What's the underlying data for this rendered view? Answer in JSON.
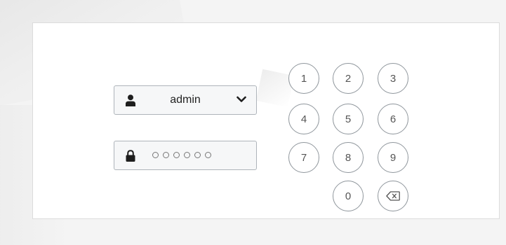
{
  "login": {
    "username": "admin",
    "password_length": 6,
    "keypad": [
      "1",
      "2",
      "3",
      "4",
      "5",
      "6",
      "7",
      "8",
      "9",
      "0"
    ],
    "icons": {
      "user": "user-icon",
      "lock": "lock-icon",
      "dropdown": "chevron-down-icon",
      "backspace": "backspace-icon"
    }
  }
}
